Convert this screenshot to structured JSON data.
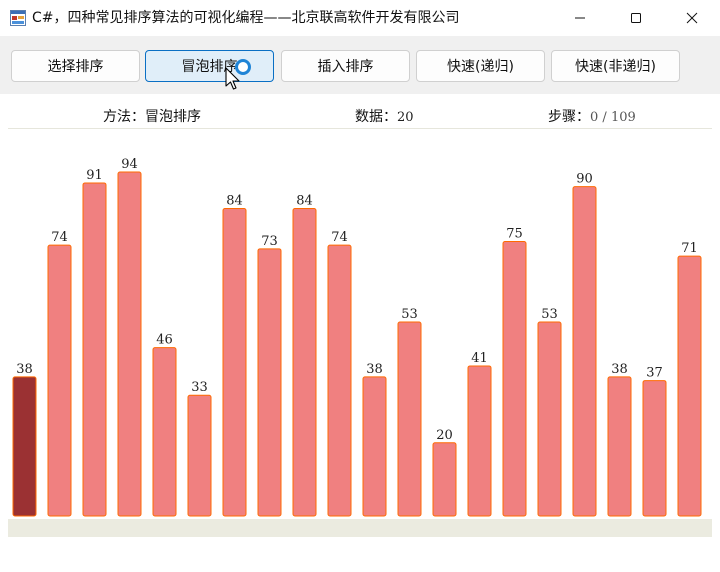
{
  "window": {
    "title": "C#，四种常见排序算法的可视化编程——北京联高软件开发有限公司"
  },
  "toolbar": {
    "buttons": [
      {
        "label": "选择排序",
        "active": false
      },
      {
        "label": "冒泡排序",
        "active": true
      },
      {
        "label": "插入排序",
        "active": false
      },
      {
        "label": "快速(递归)",
        "active": false
      },
      {
        "label": "快速(非递归)",
        "active": false
      }
    ]
  },
  "info": {
    "method_label": "方法：",
    "method_value": "冒泡排序",
    "data_label": "数据：",
    "data_value": "20",
    "steps_label": "步骤：",
    "steps_current": "0",
    "steps_separator": " / ",
    "steps_total": "109"
  },
  "colors": {
    "bar_fill": "#f08080",
    "bar_border": "#ff6a00",
    "bar_highlight": "#9b3133"
  },
  "chart_data": {
    "type": "bar",
    "values": [
      38,
      74,
      91,
      94,
      46,
      33,
      84,
      73,
      84,
      74,
      38,
      53,
      20,
      41,
      75,
      53,
      90,
      38,
      37,
      71
    ],
    "highlight_index": 0,
    "ylim": [
      0,
      100
    ]
  }
}
